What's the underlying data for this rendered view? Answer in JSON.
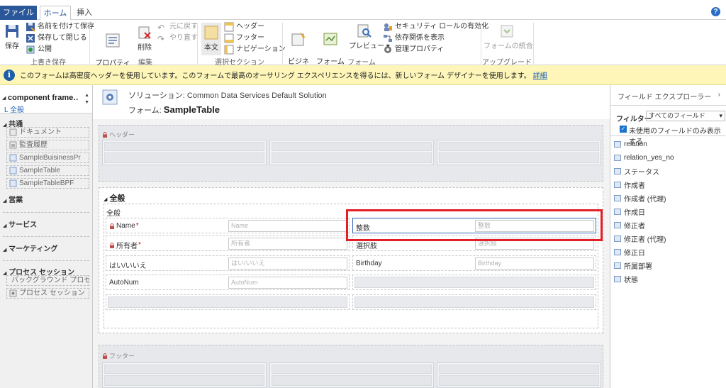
{
  "tabs": {
    "file": "ファイル",
    "home": "ホーム",
    "insert": "挿入",
    "help": "?"
  },
  "ribbon": {
    "save": "保存",
    "save_as": "名前を付けて保存",
    "save_close": "保存して閉じる",
    "publish": "公開",
    "group_save": "上書き保存",
    "properties": "プロパティの\n変更",
    "delete": "削除",
    "undo": "元に戻す",
    "redo": "やり直す",
    "group_edit": "編集",
    "body": "本文",
    "header": "ヘッダー",
    "footer": "フッター",
    "navigation": "ナビゲーション",
    "group_select": "選択セクション",
    "business_rules": "ビジネス\nルール",
    "form_properties": "フォームの\nプロパティ",
    "preview": "プレビュー",
    "security_roles": "セキュリティ ロールの有効化",
    "dependencies": "依存関係を表示",
    "manage_properties": "管理プロパティ",
    "group_form": "フォーム",
    "merge_forms": "フォームの統合",
    "group_upgrade": "アップグレード"
  },
  "infobar": {
    "text": "このフォームは高密度ヘッダーを使用しています。このフォームで最高のオーサリング エクスペリエンスを得るには、新しいフォーム デザイナーを使用します。",
    "link": "詳細"
  },
  "leftnav": {
    "title": "component frame…",
    "subtitle": "L 全般",
    "sections": {
      "common": "共通",
      "sales": "営業",
      "service": "サービス",
      "marketing": "マーケティング",
      "process": "プロセス セッション"
    },
    "common_items": [
      "ドキュメント",
      "監査履歴",
      "SampleBuisinessPr",
      "SampleTable",
      "SampleTableBPF"
    ],
    "process_items": [
      "バックグラウンド プロセス",
      "プロセス セッション"
    ]
  },
  "header": {
    "solution": "ソリューション: Common Data Services Default Solution",
    "form_label": "フォーム: ",
    "form_name": "SampleTable"
  },
  "sections": {
    "header": "ヘッダー",
    "general": "全般",
    "general_sub": "全般",
    "footer": "フッター"
  },
  "fields": {
    "name": {
      "label": "Name",
      "required": "*",
      "placeholder": "Name"
    },
    "owner": {
      "label": "所有者",
      "required": "*",
      "placeholder": "所有者"
    },
    "yesno": {
      "label": "はい/いいえ",
      "placeholder": "はい/いいえ"
    },
    "autonum": {
      "label": "AutoNum",
      "placeholder": "AutoNum"
    },
    "integer": {
      "label": "整数",
      "placeholder": "整数"
    },
    "choice": {
      "label": "選択肢",
      "placeholder": "選択肢"
    },
    "birthday": {
      "label": "Birthday",
      "placeholder": "Birthday"
    }
  },
  "explorer": {
    "title": "フィールド エクスプローラー",
    "arrow": "›",
    "filter_label": "フィルター",
    "filter_value": "すべてのフィールド",
    "only_unused": "未使用のフィールドのみ表示する",
    "fields": [
      "relation",
      "relation_yes_no",
      "ステータス",
      "作成者",
      "作成者 (代理)",
      "作成日",
      "修正者",
      "修正者 (代理)",
      "修正日",
      "所属部署",
      "状態"
    ]
  },
  "colors": {
    "file_tab": "#2a579a",
    "highlight": "#e41e26",
    "infobar": "#fdf6b8",
    "link": "#1b5fb4"
  }
}
